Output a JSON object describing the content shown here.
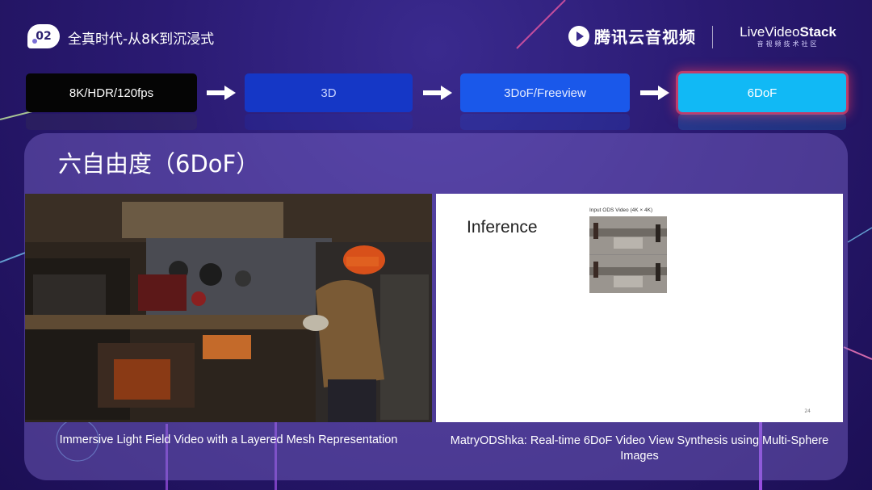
{
  "header": {
    "section_number": "02",
    "section_title": "全真时代-从8K到沉浸式",
    "brand_tencent": "腾讯云音视频",
    "brand_lvs_prefix": "LiveVideo",
    "brand_lvs_suffix": "Stack",
    "brand_lvs_sub": "音视频技术社区"
  },
  "flow": {
    "steps": [
      {
        "label": "8K/HDR/120fps"
      },
      {
        "label": "3D"
      },
      {
        "label": "3DoF/Freeview"
      },
      {
        "label": "6DoF"
      }
    ],
    "active_index": 3
  },
  "panel": {
    "title": "六自由度（6DoF）",
    "left_media": {
      "caption": "Immersive Light Field Video with a Layered Mesh Representation"
    },
    "right_media": {
      "slide_title": "Inference",
      "ods_label": "Input ODS Video (4K × 4K)",
      "slide_number": "24",
      "caption": "MatryODShka: Real-time 6DoF Video View Synthesis using Multi-Sphere Images"
    }
  },
  "colors": {
    "background": "#2a1a72",
    "step_1": "#050505",
    "step_2": "#1537c6",
    "step_3": "#1a58ea",
    "step_active": "#11b9f5",
    "active_glow": "#ff3c5a"
  }
}
